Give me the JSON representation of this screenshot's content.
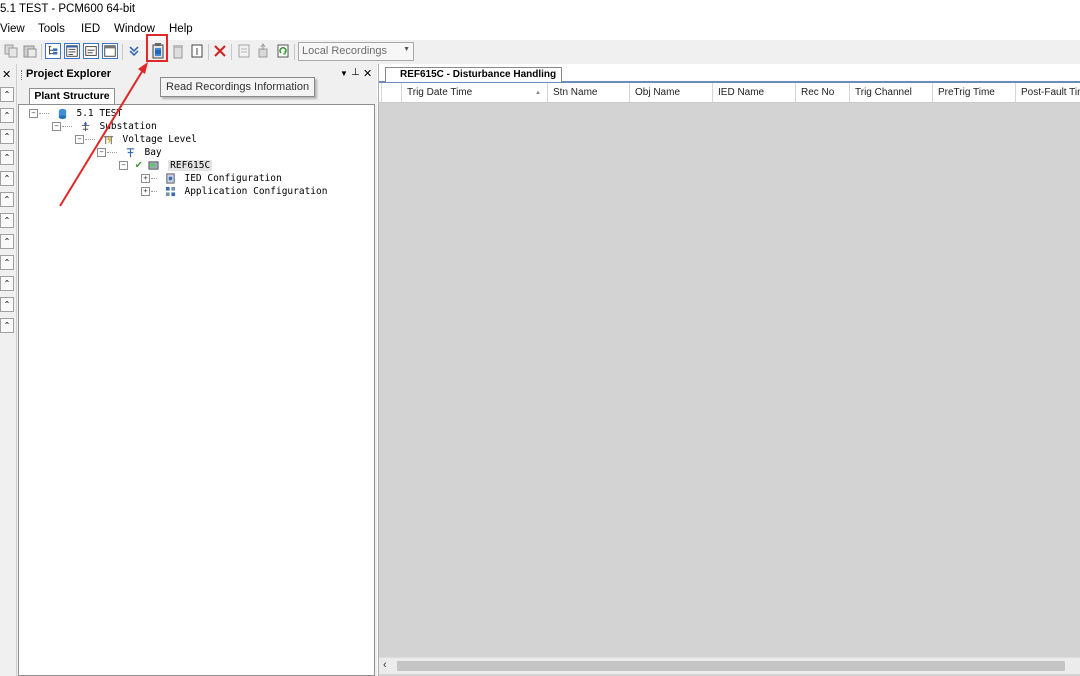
{
  "window": {
    "title": "5.1 TEST - PCM600 64-bit"
  },
  "menu": {
    "items": [
      "View",
      "Tools",
      "IED",
      "Window",
      "Help"
    ]
  },
  "toolbar": {
    "recordings_select": "Local Recordings",
    "tooltip": "Read Recordings Information"
  },
  "explorer": {
    "title": "Project Explorer",
    "tab": "Plant Structure",
    "tree": [
      {
        "label": "5.1 TEST",
        "icon": "project-icon",
        "expander": "−"
      },
      {
        "label": "Substation",
        "icon": "substation-icon",
        "expander": "−"
      },
      {
        "label": "Voltage Level",
        "icon": "voltage-level-icon",
        "expander": "−"
      },
      {
        "label": "Bay",
        "icon": "bay-icon",
        "expander": "−"
      },
      {
        "label": "REF615C",
        "icon": "ied-icon",
        "expander": "−"
      },
      {
        "label": "IED Configuration",
        "icon": "ied-configuration-icon",
        "expander": "+"
      },
      {
        "label": "Application Configuration",
        "icon": "application-configuration-icon",
        "expander": "+"
      }
    ]
  },
  "document": {
    "tab": "REF615C - Disturbance Handling",
    "columns": [
      "Trig Date Time",
      "Stn Name",
      "Obj Name",
      "IED Name",
      "Rec No",
      "Trig Channel",
      "PreTrig Time",
      "Post-Fault Time"
    ]
  },
  "colors": {
    "highlight": "#e32626",
    "arrow": "#e32626"
  }
}
